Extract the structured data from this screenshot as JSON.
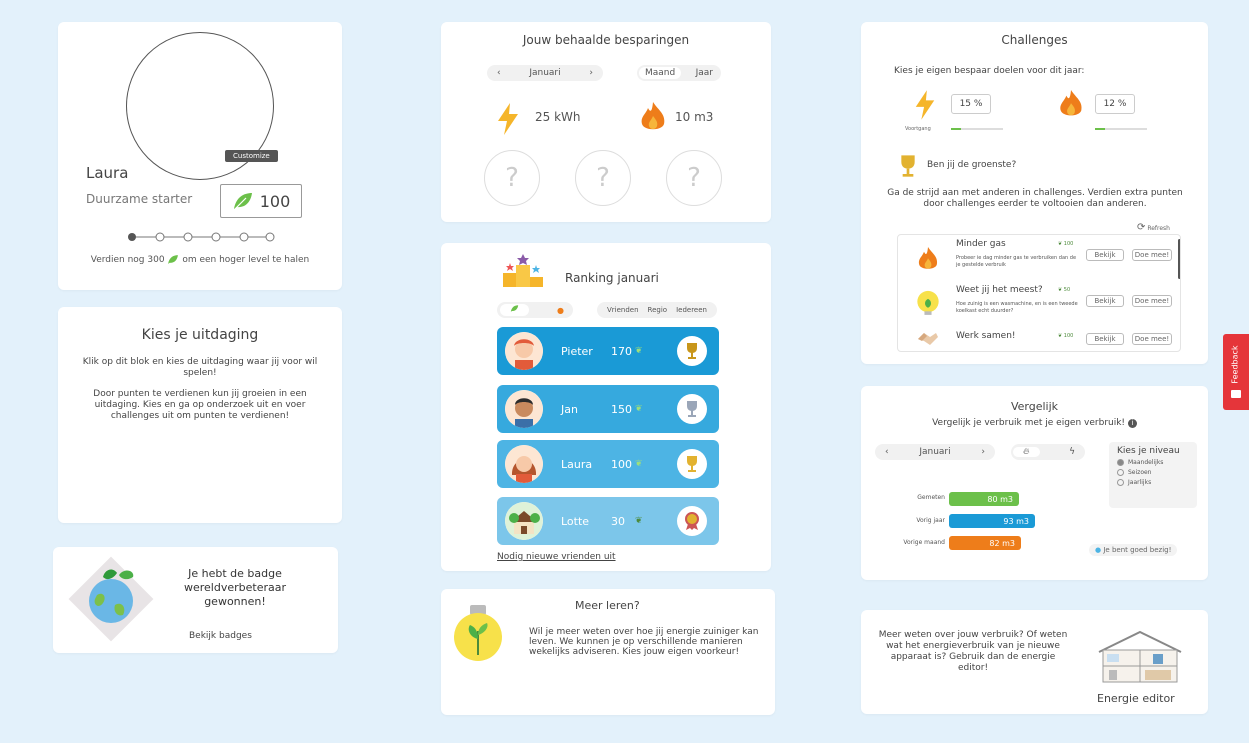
{
  "profile": {
    "customize_label": "Customize",
    "name": "Laura",
    "title": "Duurzame starter",
    "points": "100",
    "level_text_pre": "Verdien nog 300",
    "level_text_post": "om een hoger level te halen"
  },
  "challenge_pick": {
    "title": "Kies je uitdaging",
    "text1": "Klik op dit blok en kies de uitdaging waar jij voor wil spelen!",
    "text2": "Door punten te verdienen kun jij groeien in een uitdaging. Kies en ga op onderzoek uit en voer challenges uit om punten te verdienen!"
  },
  "badge": {
    "text": "Je hebt de badge wereldverbeteraar gewonnen!",
    "link": "Bekijk badges"
  },
  "savings": {
    "title": "Jouw behaalde besparingen",
    "month": "Januari",
    "prev": "‹",
    "next": "›",
    "toggle_month": "Maand",
    "toggle_year": "Jaar",
    "electricity": "25 kWh",
    "gas": "10 m3",
    "unknown": "?"
  },
  "ranking": {
    "title": "Ranking januari",
    "filters": [
      "Vrienden",
      "Regio",
      "Iedereen"
    ],
    "rows": [
      {
        "name": "Pieter",
        "points": "170",
        "color": "#1a9ad6"
      },
      {
        "name": "Jan",
        "points": "150",
        "color": "#36a9de"
      },
      {
        "name": "Laura",
        "points": "100",
        "color": "#4db4e4"
      },
      {
        "name": "Lotte",
        "points": "30",
        "color": "#7cc6ea"
      }
    ],
    "invite": "Nodig nieuwe vrienden uit"
  },
  "learn": {
    "title": "Meer leren?",
    "text": "Wil je meer weten over hoe jij energie zuiniger kan leven. We kunnen je op verschillende manieren wekelijks adviseren. Kies jouw eigen voorkeur!"
  },
  "challenges": {
    "title": "Challenges",
    "subtitle": "Kies je eigen bespaar doelen voor dit jaar:",
    "elec_goal": "15 %",
    "gas_goal": "12 %",
    "elec_caption": "Voortgang",
    "green_title": "Ben jij de groenste?",
    "green_text": "Ga de strijd aan met anderen in challenges. Verdien extra punten door challenges eerder te voltooien dan anderen.",
    "refresh": "Refresh",
    "items": [
      {
        "title": "Minder gas",
        "pts": "100",
        "desc": "Probeer ie dag minder gas te verbruiken dan de je gestelde verbruik",
        "btn1": "Bekijk",
        "btn2": "Doe mee!"
      },
      {
        "title": "Weet jij het meest?",
        "pts": "50",
        "desc": "Hoe zuinig is een wasmachine, en is een tweede koelkast echt duurder?",
        "btn1": "Bekijk",
        "btn2": "Doe mee!"
      },
      {
        "title": "Werk samen!",
        "pts": "100",
        "desc": "",
        "btn1": "Bekijk",
        "btn2": "Doe mee!"
      }
    ]
  },
  "compare": {
    "title": "Vergelijk",
    "subtitle": "Vergelijk je verbruik met je eigen verbruik!",
    "month": "Januari",
    "level_title": "Kies je niveau",
    "levels": [
      "Maandelijks",
      "Seizoen",
      "Jaarlijks"
    ],
    "bars": [
      {
        "label": "Gemeten",
        "value": "80 m3",
        "color": "#6cc04a"
      },
      {
        "label": "Vorig jaar",
        "value": "93 m3",
        "color": "#1a9ad6"
      },
      {
        "label": "Vorige maand",
        "value": "82 m3",
        "color": "#ee7d1a"
      }
    ],
    "footer": "Je bent goed bezig!"
  },
  "editor": {
    "text": "Meer weten over jouw verbruik? Of weten wat het energieverbruik van je nieuwe apparaat is? Gebruik dan de energie editor!",
    "label": "Energie editor"
  },
  "feedback": {
    "label": "Feedback"
  }
}
